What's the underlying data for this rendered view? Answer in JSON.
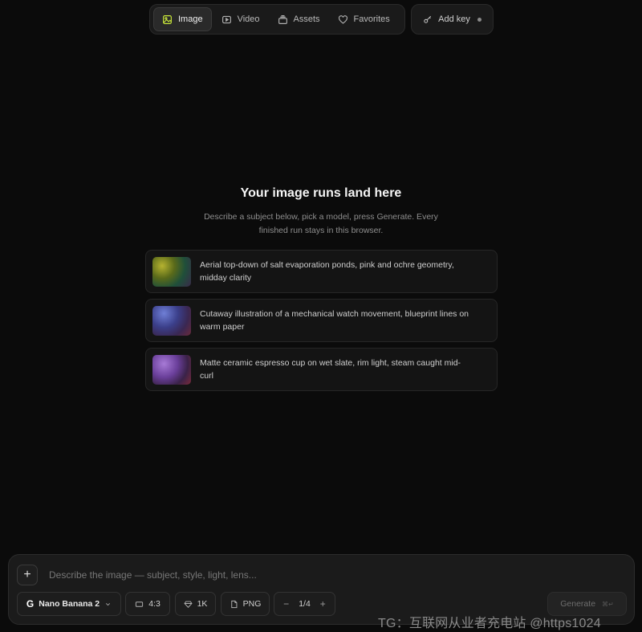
{
  "nav": {
    "tabs": [
      {
        "label": "Image",
        "icon": "image-icon",
        "active": true
      },
      {
        "label": "Video",
        "icon": "video-icon",
        "active": false
      },
      {
        "label": "Assets",
        "icon": "assets-icon",
        "active": false
      },
      {
        "label": "Favorites",
        "icon": "heart-icon",
        "active": false
      }
    ],
    "add_key_label": "Add key"
  },
  "empty_state": {
    "title": "Your image runs land here",
    "description": "Describe a subject below, pick a model, press Generate. Every finished run stays in this browser."
  },
  "suggestions": [
    {
      "text": "Aerial top-down of salt evaporation ponds, pink and ochre geometry, midday clarity"
    },
    {
      "text": "Cutaway illustration of a mechanical watch movement, blueprint lines on warm paper"
    },
    {
      "text": "Matte ceramic espresso cup on wet slate, rim light, steam caught mid-curl"
    }
  ],
  "composer": {
    "add_label": "+",
    "placeholder": "Describe the image — subject, style, light, lens...",
    "model": "Nano Banana 2",
    "model_logo": "G",
    "aspect_ratio": "4:3",
    "resolution": "1K",
    "format": "PNG",
    "count_minus": "−",
    "count": "1/4",
    "count_plus": "+",
    "generate_label": "Generate",
    "generate_shortcut": "⌘↵"
  },
  "watermark": "TG：互联网从业者充电站 @https1024"
}
